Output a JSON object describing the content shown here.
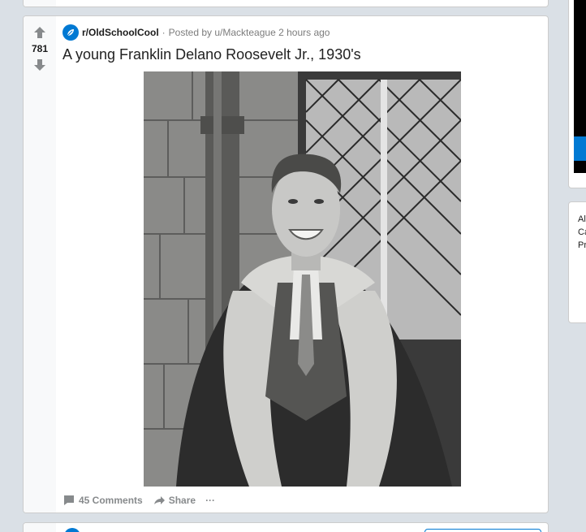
{
  "post": {
    "score": "781",
    "subreddit": "r/OldSchoolCool",
    "separator": "·",
    "posted_by": "Posted by u/Mackteague 2 hours ago",
    "title": "A young Franklin Delano Roosevelt Jr., 1930's",
    "image_alt": "Black and white photo of a smiling young man in a shearling coat",
    "actions": {
      "comments": "45 Comments",
      "share": "Share",
      "more": "···"
    }
  },
  "sidebar": {
    "text_lines": "Al\nCa\nPr"
  },
  "colors": {
    "accent": "#0079d3",
    "background": "#dae0e6"
  }
}
